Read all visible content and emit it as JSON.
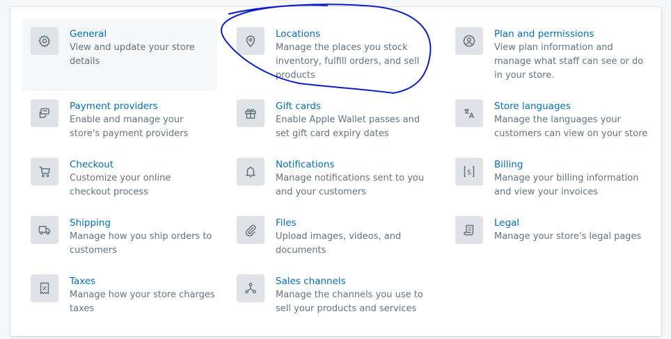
{
  "settings": {
    "items": [
      {
        "title": "General",
        "description": "View and update your store details",
        "icon": "gear-icon"
      },
      {
        "title": "Locations",
        "description": "Manage the places you stock inventory, fulfill orders, and sell products",
        "icon": "location-pin-icon"
      },
      {
        "title": "Plan and permissions",
        "description": "View plan information and manage what staff can see or do in your store.",
        "icon": "user-circle-icon"
      },
      {
        "title": "Payment providers",
        "description": "Enable and manage your store's payment providers",
        "icon": "payment-icon"
      },
      {
        "title": "Gift cards",
        "description": "Enable Apple Wallet passes and set gift card expiry dates",
        "icon": "gift-icon"
      },
      {
        "title": "Store languages",
        "description": "Manage the languages your customers can view on your store",
        "icon": "translate-icon"
      },
      {
        "title": "Checkout",
        "description": "Customize your online checkout process",
        "icon": "cart-icon"
      },
      {
        "title": "Notifications",
        "description": "Manage notifications sent to you and your customers",
        "icon": "bell-icon"
      },
      {
        "title": "Billing",
        "description": "Manage your billing information and view your invoices",
        "icon": "billing-icon"
      },
      {
        "title": "Shipping",
        "description": "Manage how you ship orders to customers",
        "icon": "truck-icon"
      },
      {
        "title": "Files",
        "description": "Upload images, videos, and documents",
        "icon": "paperclip-icon"
      },
      {
        "title": "Legal",
        "description": "Manage your store's legal pages",
        "icon": "legal-icon"
      },
      {
        "title": "Taxes",
        "description": "Manage how your store charges taxes",
        "icon": "tax-icon"
      },
      {
        "title": "Sales channels",
        "description": "Manage the channels you use to sell your products and services",
        "icon": "sales-channels-icon"
      }
    ]
  },
  "colors": {
    "link": "#006fbb",
    "text_subdued": "#637381",
    "icon_bg": "#dfe3e8",
    "icon_fg": "#637381",
    "annotation": "#0a1cc8"
  }
}
